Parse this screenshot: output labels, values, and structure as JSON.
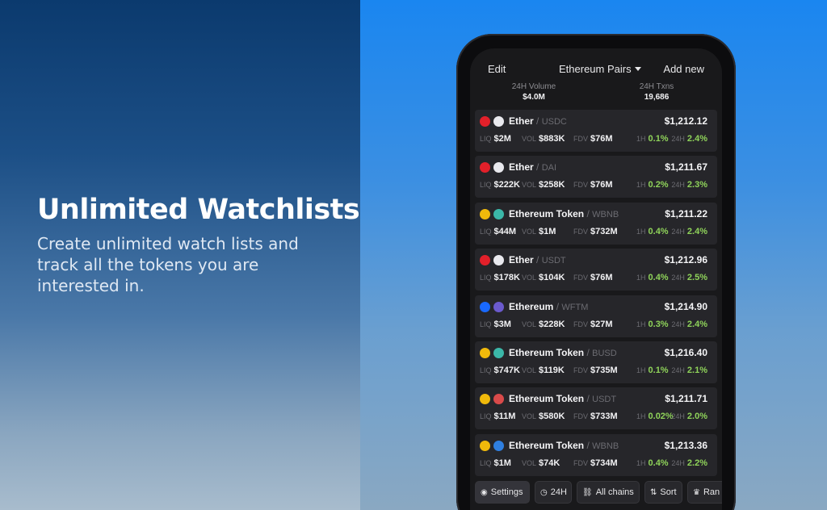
{
  "hero": {
    "headline": "Unlimited Watchlists",
    "subline": "Create unlimited watch lists and track all the tokens you are interested in."
  },
  "topbar": {
    "edit_label": "Edit",
    "list_label": "Ethereum Pairs",
    "add_label": "Add new"
  },
  "stats": {
    "volume_label": "24H Volume",
    "volume_value": "$4.0M",
    "txns_label": "24H Txns",
    "txns_value": "19,686"
  },
  "metric_labels": {
    "liq": "LIQ",
    "vol": "VOL",
    "fdv": "FDV",
    "h1": "1H",
    "h24": "24H"
  },
  "pairs": [
    {
      "base": "Ether",
      "quote": "USDC",
      "price": "$1,212.12",
      "liq": "$2M",
      "vol": "$883K",
      "fdv": "$76M",
      "h1": "0.1%",
      "h24": "2.4%",
      "chain_icon": "fantom-chain-icon",
      "dex_icon": "spooky-dex-icon",
      "chain_color": "#e2202a",
      "dex_color": "#e9e9ee"
    },
    {
      "base": "Ether",
      "quote": "DAI",
      "price": "$1,211.67",
      "liq": "$222K",
      "vol": "$258K",
      "fdv": "$76M",
      "h1": "0.2%",
      "h24": "2.3%",
      "chain_icon": "fantom-chain-icon",
      "dex_icon": "spooky-dex-icon",
      "chain_color": "#e2202a",
      "dex_color": "#e9e9ee"
    },
    {
      "base": "Ethereum Token",
      "quote": "WBNB",
      "price": "$1,211.22",
      "liq": "$44M",
      "vol": "$1M",
      "fdv": "$732M",
      "h1": "0.4%",
      "h24": "2.4%",
      "chain_icon": "bnb-chain-icon",
      "dex_icon": "pancakeswap-dex-icon",
      "chain_color": "#f0b90b",
      "dex_color": "#3bb7a8"
    },
    {
      "base": "Ether",
      "quote": "USDT",
      "price": "$1,212.96",
      "liq": "$178K",
      "vol": "$104K",
      "fdv": "$76M",
      "h1": "0.4%",
      "h24": "2.5%",
      "chain_icon": "fantom-chain-icon",
      "dex_icon": "spooky-dex-icon",
      "chain_color": "#e2202a",
      "dex_color": "#e9e9ee"
    },
    {
      "base": "Ethereum",
      "quote": "WFTM",
      "price": "$1,214.90",
      "liq": "$3M",
      "vol": "$228K",
      "fdv": "$27M",
      "h1": "0.3%",
      "h24": "2.4%",
      "chain_icon": "fantom-blue-chain-icon",
      "dex_icon": "spirit-dex-icon",
      "chain_color": "#1969ff",
      "dex_color": "#6b5acd"
    },
    {
      "base": "Ethereum Token",
      "quote": "BUSD",
      "price": "$1,216.40",
      "liq": "$747K",
      "vol": "$119K",
      "fdv": "$735M",
      "h1": "0.1%",
      "h24": "2.1%",
      "chain_icon": "bnb-chain-icon",
      "dex_icon": "pancakeswap-dex-icon",
      "chain_color": "#f0b90b",
      "dex_color": "#3bb7a8"
    },
    {
      "base": "Ethereum Token",
      "quote": "USDT",
      "price": "$1,211.71",
      "liq": "$11M",
      "vol": "$580K",
      "fdv": "$733M",
      "h1": "0.02%",
      "h24": "2.0%",
      "chain_icon": "bnb-chain-icon",
      "dex_icon": "biswap-dex-icon",
      "chain_color": "#f0b90b",
      "dex_color": "#d94a4a"
    },
    {
      "base": "Ethereum Token",
      "quote": "WBNB",
      "price": "$1,213.36",
      "liq": "$1M",
      "vol": "$74K",
      "fdv": "$734M",
      "h1": "0.4%",
      "h24": "2.2%",
      "chain_icon": "bnb-chain-icon",
      "dex_icon": "apeswap-dex-icon",
      "chain_color": "#f0b90b",
      "dex_color": "#2f7fe0"
    }
  ],
  "toolbar": {
    "settings": "Settings",
    "timeframe": "24H",
    "chains": "All chains",
    "sort": "Sort",
    "rank": "Ran"
  },
  "colors": {
    "positive": "#8fd35a",
    "card_bg": "#26262a",
    "screen_bg": "#19191b"
  }
}
